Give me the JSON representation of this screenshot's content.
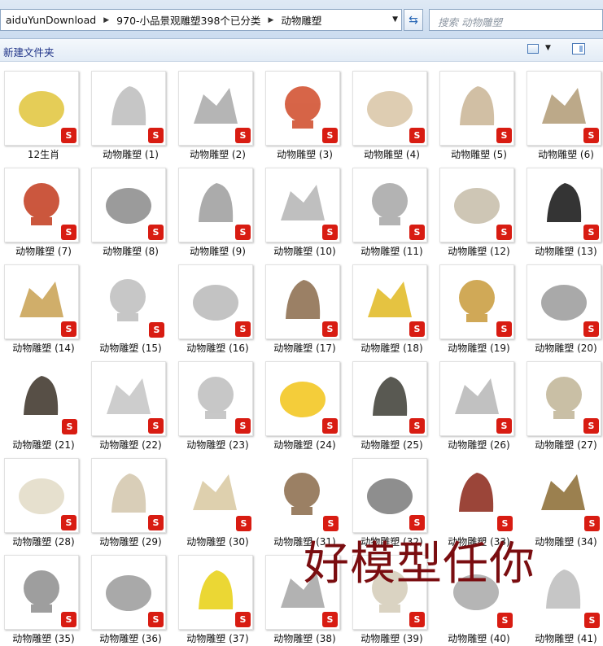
{
  "address": {
    "crumbs": [
      "aiduYunDownload",
      "970-小品景观雕塑398个已分类",
      "动物雕塑"
    ],
    "search_placeholder": "搜索 动物雕塑"
  },
  "toolbar": {
    "new_folder_label": "新建文件夹"
  },
  "badge_glyph": "S",
  "watermark": "好模型任你",
  "files": [
    {
      "label": "12生肖",
      "color": "#e0c43a"
    },
    {
      "label": "动物雕塑 (1)",
      "color": "#bcbcbc"
    },
    {
      "label": "动物雕塑 (2)",
      "color": "#a8a8a8"
    },
    {
      "label": "动物雕塑 (3)",
      "color": "#d04a28"
    },
    {
      "label": "动物雕塑 (4)",
      "color": "#d8c4a4"
    },
    {
      "label": "动物雕塑 (5)",
      "color": "#c9b494"
    },
    {
      "label": "动物雕塑 (6)",
      "color": "#b09a74"
    },
    {
      "label": "动物雕塑 (7)",
      "color": "#c23a1c"
    },
    {
      "label": "动物雕塑 (8)",
      "color": "#8a8a8a"
    },
    {
      "label": "动物雕塑 (9)",
      "color": "#9c9c9c"
    },
    {
      "label": "动物雕塑 (10)",
      "color": "#b4b4b4"
    },
    {
      "label": "动物雕塑 (11)",
      "color": "#a6a6a6"
    },
    {
      "label": "动物雕塑 (12)",
      "color": "#c6bca8"
    },
    {
      "label": "动物雕塑 (13)",
      "color": "#111111"
    },
    {
      "label": "动物雕塑 (14)",
      "color": "#c8a050"
    },
    {
      "label": "动物雕塑 (15)",
      "color": "#bdbdbd"
    },
    {
      "label": "动物雕塑 (16)",
      "color": "#b8b8b8"
    },
    {
      "label": "动物雕塑 (17)",
      "color": "#8a6a4a"
    },
    {
      "label": "动物雕塑 (18)",
      "color": "#e0b820"
    },
    {
      "label": "动物雕塑 (19)",
      "color": "#c89a3a"
    },
    {
      "label": "动物雕塑 (20)",
      "color": "#9a9a9a"
    },
    {
      "label": "动物雕塑 (21)",
      "color": "#3a3026"
    },
    {
      "label": "动物雕塑 (22)",
      "color": "#c4c4c4"
    },
    {
      "label": "动物雕塑 (23)",
      "color": "#bebebe"
    },
    {
      "label": "动物雕塑 (24)",
      "color": "#f2c418"
    },
    {
      "label": "动物雕塑 (25)",
      "color": "#3c3c34"
    },
    {
      "label": "动物雕塑 (26)",
      "color": "#b6b6b6"
    },
    {
      "label": "动物雕塑 (27)",
      "color": "#c0b496"
    },
    {
      "label": "动物雕塑 (28)",
      "color": "#e2dac6"
    },
    {
      "label": "动物雕塑 (29)",
      "color": "#d2c6ac"
    },
    {
      "label": "动物雕塑 (30)",
      "color": "#d8c8a0"
    },
    {
      "label": "动物雕塑 (31)",
      "color": "#8a6a4a"
    },
    {
      "label": "动物雕塑 (32)",
      "color": "#7a7a7a"
    },
    {
      "label": "动物雕塑 (33)",
      "color": "#8a2416"
    },
    {
      "label": "动物雕塑 (34)",
      "color": "#8a6a30"
    },
    {
      "label": "动物雕塑 (35)",
      "color": "#8e8e8e"
    },
    {
      "label": "动物雕塑 (36)",
      "color": "#9a9a9a"
    },
    {
      "label": "动物雕塑 (37)",
      "color": "#e8d010"
    },
    {
      "label": "动物雕塑 (38)",
      "color": "#a4a4a4"
    },
    {
      "label": "动物雕塑 (39)",
      "color": "#d4ccb8"
    },
    {
      "label": "动物雕塑 (40)",
      "color": "#a8a8a8"
    },
    {
      "label": "动物雕塑 (41)",
      "color": "#bcbcbc"
    }
  ]
}
